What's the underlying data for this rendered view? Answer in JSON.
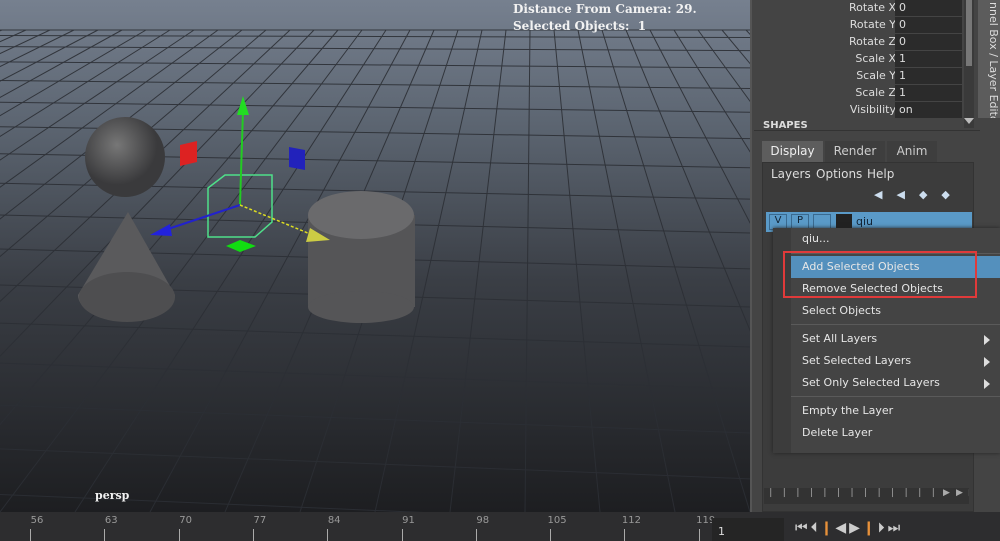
{
  "viewport": {
    "hud_distance": "Distance From Camera: 29.",
    "hud_selected": "Selected Objects:  1",
    "camera": "persp"
  },
  "channel_box": {
    "rows": [
      {
        "label": "Rotate X",
        "value": "0"
      },
      {
        "label": "Rotate Y",
        "value": "0"
      },
      {
        "label": "Rotate Z",
        "value": "0"
      },
      {
        "label": "Scale X",
        "value": "1"
      },
      {
        "label": "Scale Y",
        "value": "1"
      },
      {
        "label": "Scale Z",
        "value": "1"
      },
      {
        "label": "Visibility",
        "value": "on"
      }
    ],
    "section": "SHAPES",
    "side_tab": "nnel Box / Layer Editor"
  },
  "layer_editor": {
    "tabs": [
      "Display",
      "Render",
      "Anim"
    ],
    "menu": [
      "Layers",
      "Options",
      "Help"
    ],
    "layer": {
      "v": "V",
      "p": "P",
      "name": "qiu"
    }
  },
  "context_menu": {
    "items": [
      "qiu...",
      "Add Selected Objects",
      "Remove Selected Objects",
      "Select Objects",
      "Set All Layers",
      "Set Selected Layers",
      "Set Only Selected Layers",
      "Empty the Layer",
      "Delete Layer"
    ],
    "highlight_color": "#5490bd",
    "annotation_color": "#e03a3a"
  },
  "timeline": {
    "ticks": [
      "56",
      "63",
      "70",
      "77",
      "84",
      "91",
      "98",
      "105",
      "112",
      "119"
    ],
    "current_frame": "1"
  },
  "colors": {
    "accent": "#5490bd",
    "layer_row": "#5a9ac8"
  }
}
